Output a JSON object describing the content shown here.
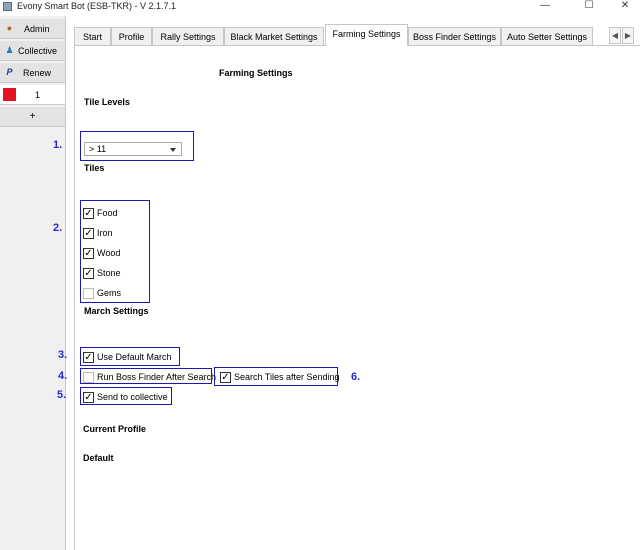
{
  "window": {
    "title": "Evony Smart Bot (ESB-TKR) - V 2.1.7.1",
    "minimize": "—",
    "maximize": "☐",
    "close": "✕"
  },
  "sidebar": {
    "admin": "Admin",
    "collective": "Collective",
    "renew": "Renew",
    "profile_number": "1",
    "add": "+"
  },
  "tabs": [
    {
      "label": "Start"
    },
    {
      "label": "Profile"
    },
    {
      "label": "Rally Settings"
    },
    {
      "label": "Black Market Settings"
    },
    {
      "label": "Farming Settings",
      "active": true
    },
    {
      "label": "Boss Finder Settings"
    },
    {
      "label": "Auto Setter Settings"
    }
  ],
  "tab_nav": {
    "prev": "◀",
    "next": "▶"
  },
  "farming": {
    "title": "Farming Settings",
    "tile_levels_heading": "Tile Levels",
    "tile_level_value": "> 11",
    "tiles_heading": "Tiles",
    "tiles": [
      {
        "label": "Food",
        "checked": true
      },
      {
        "label": "Iron",
        "checked": true
      },
      {
        "label": "Wood",
        "checked": true
      },
      {
        "label": "Stone",
        "checked": true
      },
      {
        "label": "Gems",
        "checked": false
      }
    ],
    "march_settings_heading": "March Settings",
    "use_default_march": {
      "label": "Use Default March",
      "checked": true
    },
    "run_boss_finder": {
      "label": "Run Boss Finder After Search",
      "checked": false
    },
    "search_tiles_after_sending": {
      "label": "Search Tiles after Sending",
      "checked": true
    },
    "send_to_collective": {
      "label": "Send to collective",
      "checked": true
    },
    "current_profile_heading": "Current Profile",
    "current_profile_value": "Default"
  },
  "annotations": [
    "1.",
    "2.",
    "3.",
    "4.",
    "5.",
    "6."
  ],
  "colors": {
    "annotation": "#1a1ab0",
    "profile_swatch": "#e81123"
  }
}
